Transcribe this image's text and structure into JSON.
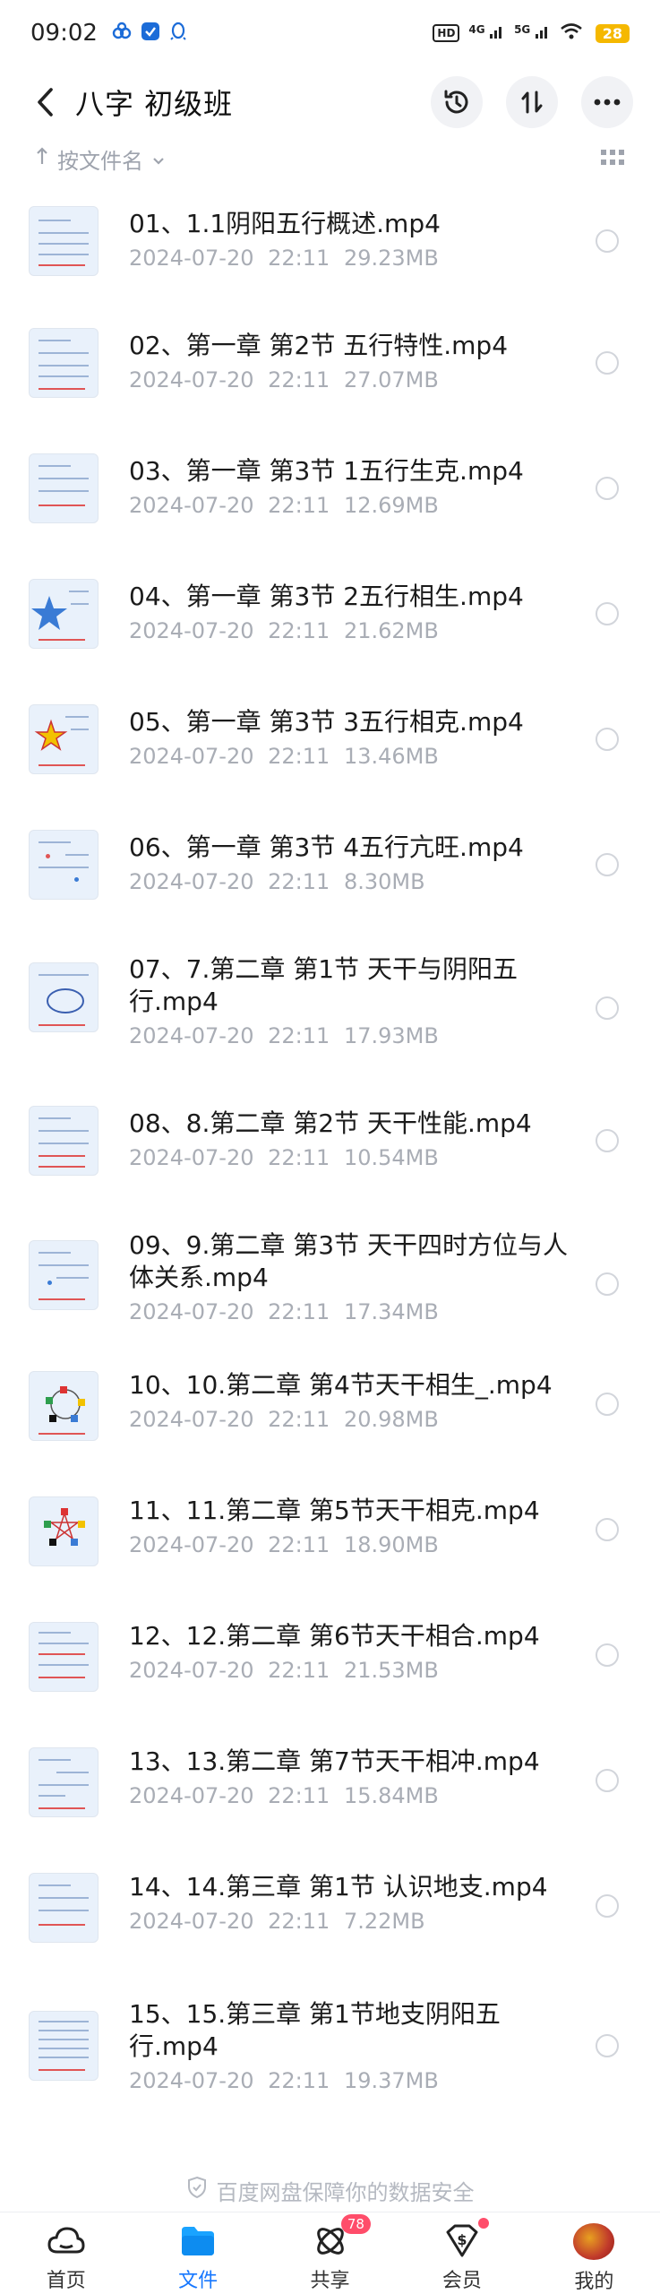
{
  "status_bar": {
    "time": "09:02",
    "hd_label": "HD",
    "network_4g": "4G",
    "network_5g": "5G",
    "battery": "28"
  },
  "header": {
    "title": "八字 初级班"
  },
  "sort": {
    "label": "按文件名"
  },
  "files": [
    {
      "name": "01、1.1阴阳五行概述.mp4",
      "date": "2024-07-20",
      "time": "22:11",
      "size": "29.23MB"
    },
    {
      "name": "02、第一章 第2节 五行特性.mp4",
      "date": "2024-07-20",
      "time": "22:11",
      "size": "27.07MB"
    },
    {
      "name": "03、第一章 第3节 1五行生克.mp4",
      "date": "2024-07-20",
      "time": "22:11",
      "size": "12.69MB"
    },
    {
      "name": "04、第一章 第3节 2五行相生.mp4",
      "date": "2024-07-20",
      "time": "22:11",
      "size": "21.62MB"
    },
    {
      "name": "05、第一章 第3节 3五行相克.mp4",
      "date": "2024-07-20",
      "time": "22:11",
      "size": "13.46MB"
    },
    {
      "name": "06、第一章 第3节 4五行亢旺.mp4",
      "date": "2024-07-20",
      "time": "22:11",
      "size": "8.30MB"
    },
    {
      "name": "07、7.第二章 第1节 天干与阴阳五行.mp4",
      "date": "2024-07-20",
      "time": "22:11",
      "size": "17.93MB"
    },
    {
      "name": "08、8.第二章 第2节 天干性能.mp4",
      "date": "2024-07-20",
      "time": "22:11",
      "size": "10.54MB"
    },
    {
      "name": "09、9.第二章 第3节 天干四时方位与人体关系.mp4",
      "date": "2024-07-20",
      "time": "22:11",
      "size": "17.34MB"
    },
    {
      "name": "10、10.第二章 第4节天干相生_.mp4",
      "date": "2024-07-20",
      "time": "22:11",
      "size": "20.98MB"
    },
    {
      "name": "11、11.第二章 第5节天干相克.mp4",
      "date": "2024-07-20",
      "time": "22:11",
      "size": "18.90MB"
    },
    {
      "name": "12、12.第二章 第6节天干相合.mp4",
      "date": "2024-07-20",
      "time": "22:11",
      "size": "21.53MB"
    },
    {
      "name": "13、13.第二章 第7节天干相冲.mp4",
      "date": "2024-07-20",
      "time": "22:11",
      "size": "15.84MB"
    },
    {
      "name": "14、14.第三章 第1节 认识地支.mp4",
      "date": "2024-07-20",
      "time": "22:11",
      "size": "7.22MB"
    },
    {
      "name": "15、15.第三章 第1节地支阴阳五行.mp4",
      "date": "2024-07-20",
      "time": "22:11",
      "size": "19.37MB"
    }
  ],
  "footer_note": "百度网盘保障你的数据安全",
  "bottom_nav": {
    "home": "首页",
    "files": "文件",
    "share": "共享",
    "share_badge": "78",
    "member": "会员",
    "mine": "我的"
  },
  "colors": {
    "accent": "#1677ff",
    "badge": "#ff4d6a",
    "meta_text": "#a9adb5"
  }
}
